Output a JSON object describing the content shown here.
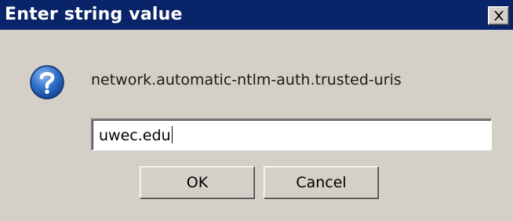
{
  "dialog": {
    "title": "Enter string value",
    "close_icon": "close-icon",
    "icon": "question-icon",
    "pref_name": "network.automatic-ntlm-auth.trusted-uris",
    "input_value": "uwec.edu",
    "ok_label": "OK",
    "cancel_label": "Cancel"
  },
  "colors": {
    "titlebar": "#0a246a",
    "window": "#d4d0c8",
    "icon_blue": "#1f5fb8"
  }
}
